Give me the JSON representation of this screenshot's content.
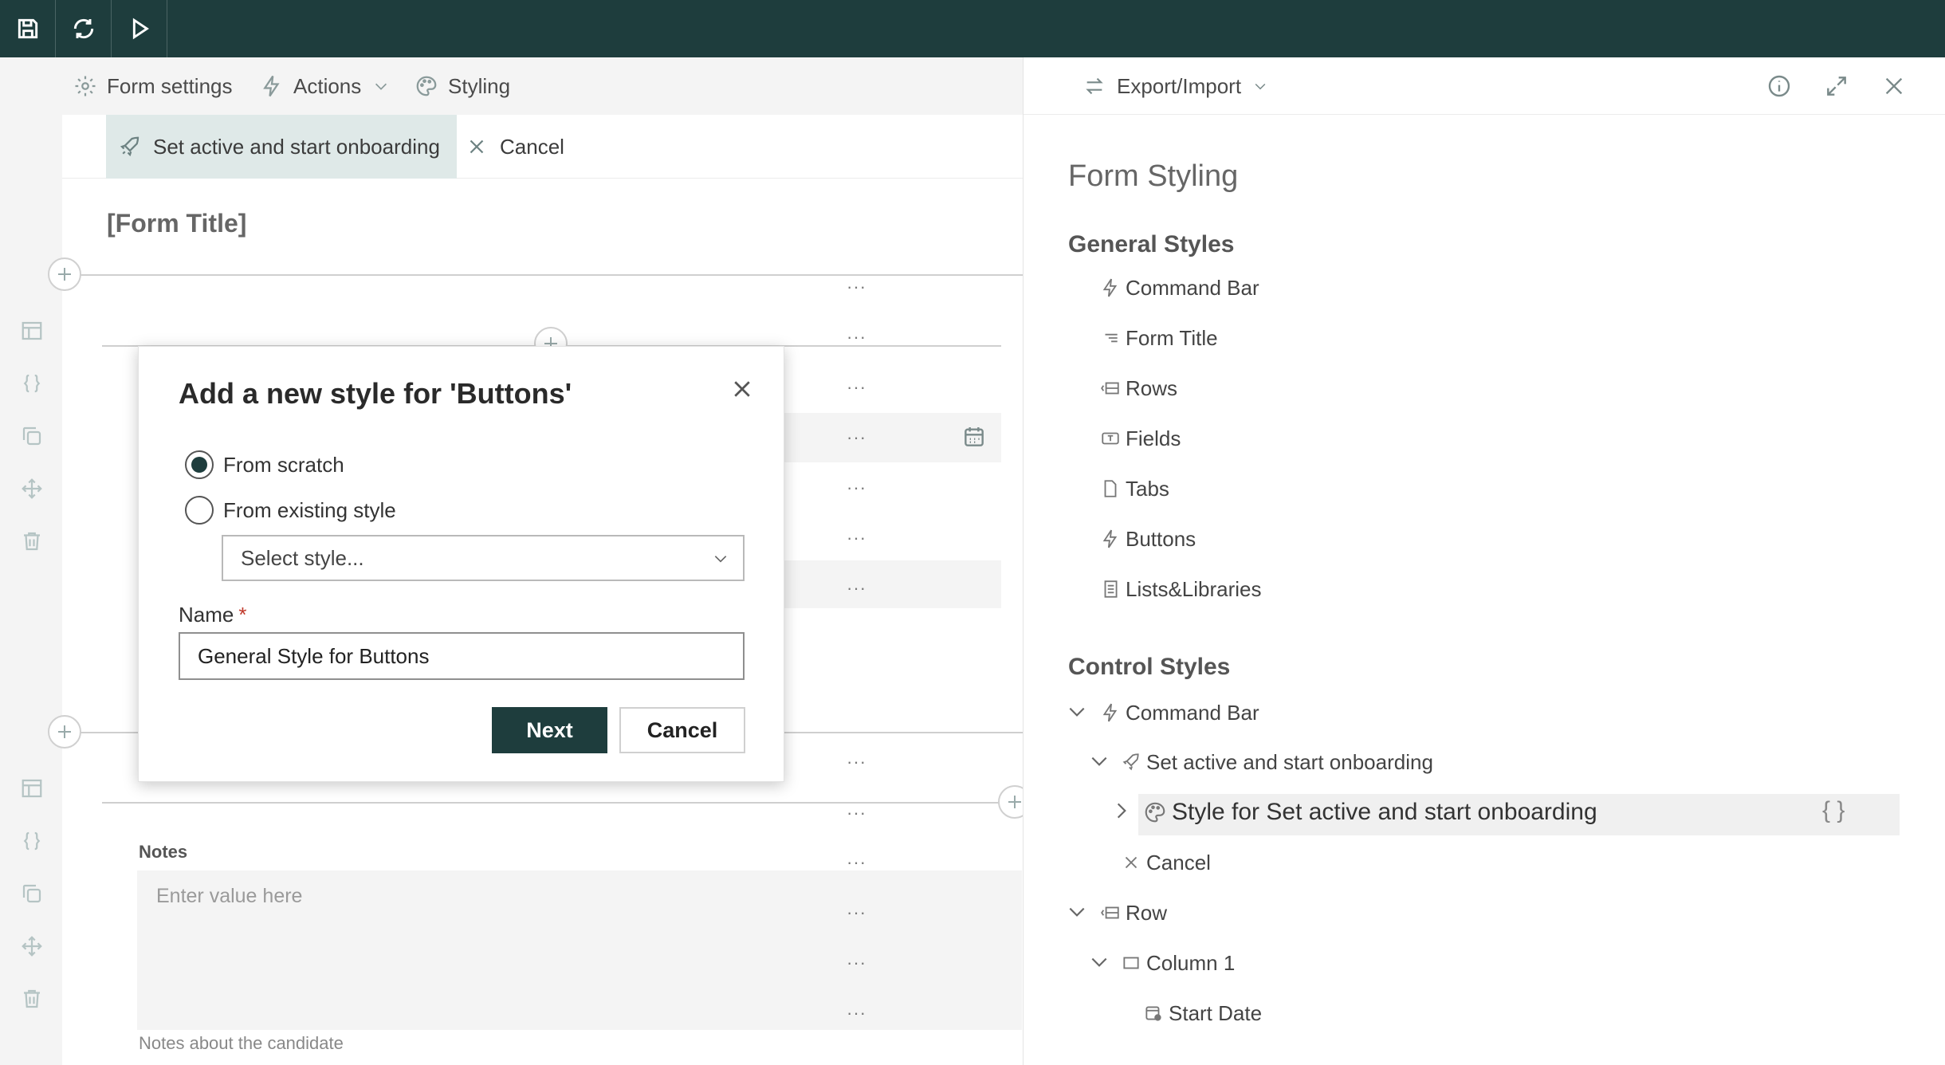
{
  "toolbar": {
    "save_icon": "save-icon",
    "refresh_icon": "refresh-icon",
    "run_icon": "play-icon"
  },
  "tabs": [
    {
      "label": "Form settings",
      "icon": "gear-icon"
    },
    {
      "label": "Actions",
      "icon": "lightning-icon"
    },
    {
      "label": "Styling",
      "icon": "palette-icon"
    }
  ],
  "command_bar": {
    "primary_label": "Set active and start onboarding",
    "cancel_label": "Cancel"
  },
  "form": {
    "title": "[Form Title]",
    "notes_label": "Notes",
    "notes_placeholder": "Enter value here",
    "notes_help": "Notes about the candidate"
  },
  "modal": {
    "title": "Add a new style for 'Buttons'",
    "option_scratch": "From scratch",
    "option_existing": "From existing style",
    "selected_option": "From scratch",
    "select_placeholder": "Select style...",
    "name_label": "Name",
    "name_required": "*",
    "name_value": "General Style for Buttons",
    "next_label": "Next",
    "cancel_label": "Cancel"
  },
  "panel": {
    "export_label": "Export/Import",
    "title": "Form Styling",
    "general_heading": "General Styles",
    "general_items": [
      {
        "label": "Command Bar",
        "icon": "lightning-icon"
      },
      {
        "label": "Form Title",
        "icon": "title-icon"
      },
      {
        "label": "Rows",
        "icon": "rows-icon"
      },
      {
        "label": "Fields",
        "icon": "field-icon"
      },
      {
        "label": "Tabs",
        "icon": "tab-icon"
      },
      {
        "label": "Buttons",
        "icon": "lightning-icon"
      },
      {
        "label": "Lists&Libraries",
        "icon": "list-icon"
      }
    ],
    "control_heading": "Control Styles",
    "control_items": [
      {
        "label": "Command Bar",
        "icon": "lightning-icon"
      },
      {
        "label": "Set active and start onboarding",
        "icon": "rocket-icon"
      },
      {
        "label": "Style for Set active and start onboarding",
        "icon": "palette-icon"
      },
      {
        "label": "Cancel",
        "icon": "close-icon"
      },
      {
        "label": "Row",
        "icon": "rows-icon"
      },
      {
        "label": "Column 1",
        "icon": "column-icon"
      },
      {
        "label": "Start Date",
        "icon": "calendar-icon"
      }
    ],
    "braces": "{ }",
    "more": "···"
  }
}
